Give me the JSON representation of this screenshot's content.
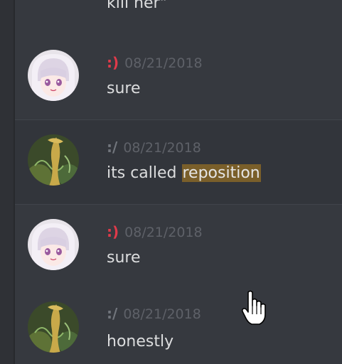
{
  "colors": {
    "background": "#36393f",
    "hover_row": "#32353b",
    "text": "#dcddde",
    "timestamp": "#5e6168",
    "highlight": "#7a5f2a",
    "user_smile": "#e03a4a",
    "user_slash": "#72767d"
  },
  "fragment": {
    "text": "kill her\""
  },
  "messages": [
    {
      "username": ":)",
      "timestamp": "08/21/2018",
      "text": "sure",
      "avatar": "anime-girl-avatar"
    },
    {
      "username": ":/",
      "timestamp": "08/21/2018",
      "text_before": "its called ",
      "text_highlight": "reposition",
      "avatar": "creature-avatar"
    },
    {
      "username": ":)",
      "timestamp": "08/21/2018",
      "text": "sure",
      "avatar": "anime-girl-avatar"
    },
    {
      "username": ":/",
      "timestamp": "08/21/2018",
      "text": "honestly",
      "avatar": "creature-avatar"
    }
  ],
  "cursor": {
    "icon": "hand-pointer-icon"
  }
}
